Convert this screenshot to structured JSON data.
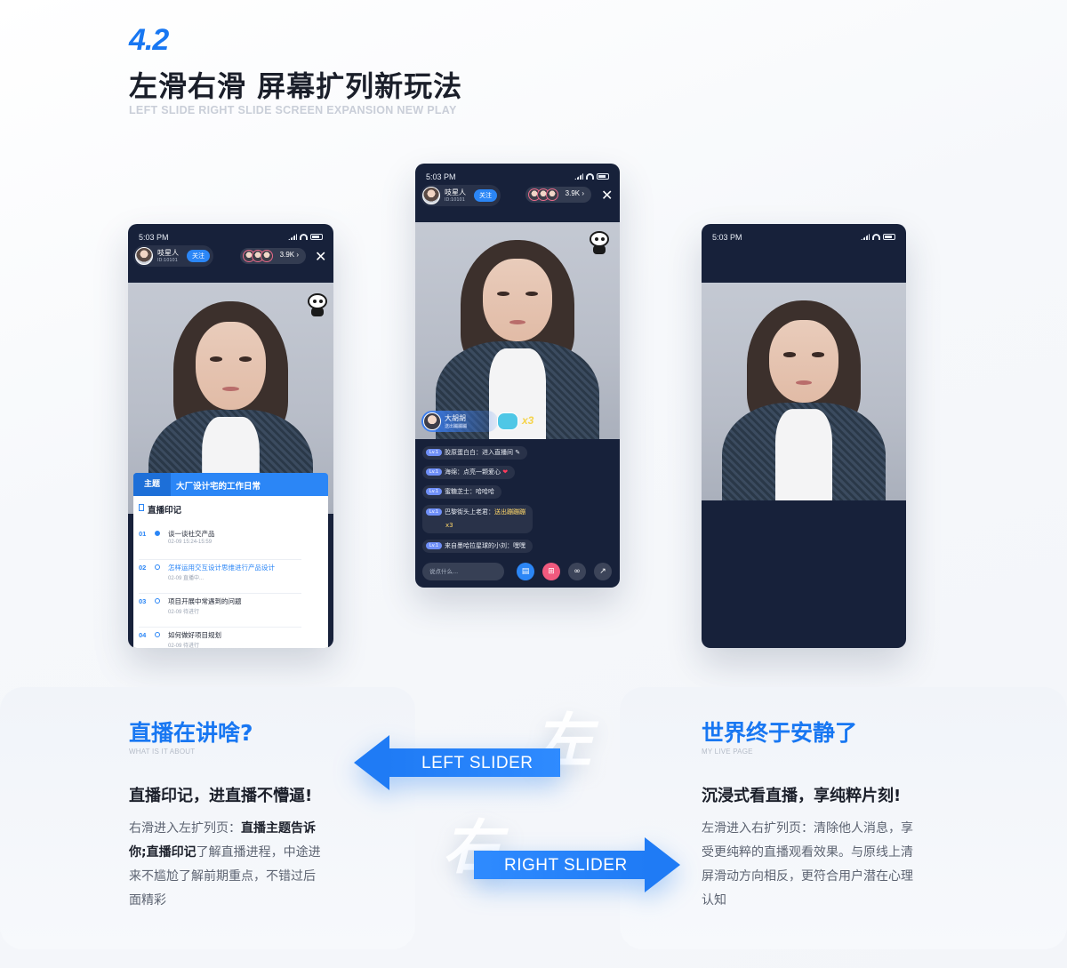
{
  "header": {
    "number": "4.2",
    "title": "左滑右滑  屏幕扩列新玩法",
    "subtitle": "LEFT SLIDE RIGHT SLIDE SCREEN EXPANSION NEW PLAY"
  },
  "phone_left": {
    "time": "5:03 PM",
    "host_name": "吱星人",
    "host_id": "ID:10101",
    "follow_label": "关注",
    "viewer_count": "3.9K ›",
    "close": "✕",
    "topic_tag": "主题",
    "topic_text": "大厂设计宅的工作日常",
    "record_title": "直播印记",
    "records": [
      {
        "num": "01",
        "title": "谈一谈社交产品",
        "meta": "02-09   15:24-15:59"
      },
      {
        "num": "02",
        "title": "怎样运用交互设计思维进行产品设计",
        "meta": "02-09   直播中..."
      },
      {
        "num": "03",
        "title": "项目开展中常遇到的问题",
        "meta": "02-09   待进行"
      },
      {
        "num": "04",
        "title": "如何做好项目规划",
        "meta": "02-09   待进行"
      }
    ]
  },
  "phone_middle": {
    "time": "5:03 PM",
    "host_name": "吱星人",
    "host_id": "ID:10101",
    "follow_label": "关注",
    "viewer_count": "3.9K ›",
    "close": "✕",
    "gift_sender": "大胡胡",
    "gift_desc": "送出蹦蹦蹦",
    "gift_count": "x3",
    "chat": [
      {
        "level": "Lv.1",
        "user": "胶原蛋白白：",
        "msg": "进入直播间 ✎"
      },
      {
        "level": "Lv.1",
        "user": "海绵：",
        "msg": "点亮一颗爱心",
        "extra": "❤"
      },
      {
        "level": "Lv.1",
        "user": "蜜糖芝士：",
        "msg": "哈哈哈"
      },
      {
        "level": "Lv.1",
        "user": "巴黎街头上老君：",
        "msg": "送出蹦蹦蹦",
        "extra2": "x3"
      },
      {
        "level": "Lv.1",
        "user": "来自墨哈拉星球的小刘：",
        "msg": "嘿嘿"
      }
    ],
    "input_placeholder": "说点什么..."
  },
  "phone_right": {
    "time": "5:03 PM"
  },
  "card_left": {
    "title": "直播在讲啥?",
    "sub": "WHAT IS IT ABOUT",
    "headline": "直播印记，进直播不懵逼!",
    "body_1": "右滑进入左扩列页：",
    "body_b1": "直播主题",
    "body_b2": "告诉你;直播印记",
    "body_2": "了解直播进程，中途进来不尴尬了解前期重点，不错过后面精彩"
  },
  "card_right": {
    "title": "世界终于安静了",
    "sub": "MY LIVE PAGE",
    "headline": "沉浸式看直播，享纯粹片刻!",
    "body": "左滑进入右扩列页：清除他人消息，享受更纯粹的直播观看效果。与原线上清屏滑动方向相反，更符合用户潜在心理认知"
  },
  "arrows": {
    "left_label": "LEFT SLIDER",
    "left_ghost": "左",
    "right_label": "RIGHT SLIDER",
    "right_ghost": "右"
  },
  "colors": {
    "accent": "#1877f2",
    "phone_bg": "#17213a",
    "card_bg": "#f1f4f9"
  }
}
